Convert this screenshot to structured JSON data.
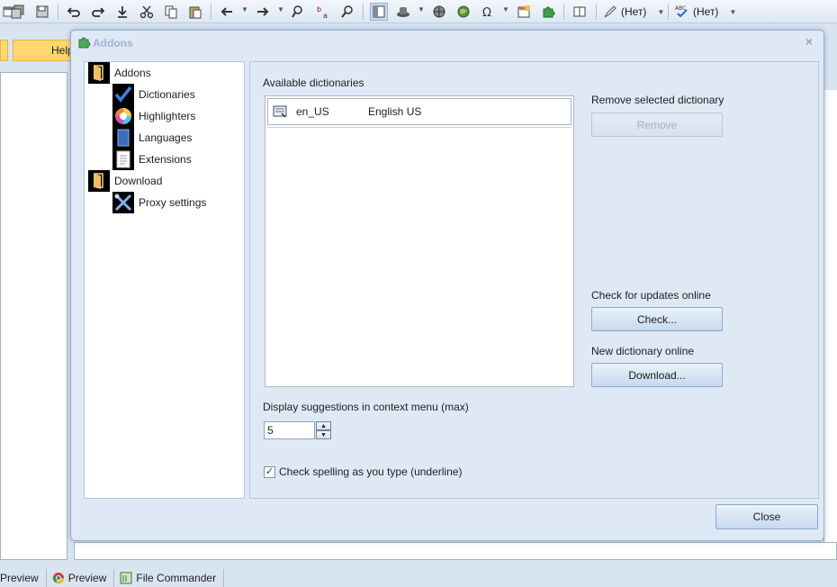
{
  "background": {
    "toolbar": {
      "icons": [
        "window-icon",
        "save-all-icon",
        "save-icon",
        "undo-icon",
        "redo-icon",
        "download-icon",
        "cut-icon",
        "copy-icon",
        "paste-icon",
        "back-icon",
        "forward-icon",
        "find-icon",
        "replace-icon",
        "find-next-icon",
        "layout-icon",
        "hat-icon",
        "globe-icon",
        "globe-green-icon",
        "omega-icon",
        "calendar-icon",
        "puzzle-icon",
        "split-icon"
      ],
      "style_combo_label": "(Нет)",
      "spell_combo_label": "(Нет)"
    },
    "tab_label": "Help",
    "taskbar": [
      {
        "label": "Preview"
      },
      {
        "label": "Preview"
      },
      {
        "label": "File Commander"
      }
    ]
  },
  "dialog": {
    "title": "Addons",
    "close_glyph": "×",
    "tree": [
      {
        "label": "Addons",
        "icon": "folder-icon",
        "level": 0
      },
      {
        "label": "Dictionaries",
        "icon": "checkmark-icon",
        "level": 1
      },
      {
        "label": "Highlighters",
        "icon": "color-wheel-icon",
        "level": 1
      },
      {
        "label": "Languages",
        "icon": "book-icon",
        "level": 1
      },
      {
        "label": "Extensions",
        "icon": "document-icon",
        "level": 1
      },
      {
        "label": "Download",
        "icon": "folder-icon",
        "level": 0
      },
      {
        "label": "Proxy settings",
        "icon": "tools-icon",
        "level": 1
      }
    ],
    "available_label": "Available dictionaries",
    "dictionaries": [
      {
        "code": "en_US",
        "name": "English US"
      }
    ],
    "remove_section_label": "Remove selected dictionary",
    "remove_button": "Remove",
    "check_section_label": "Check for updates online",
    "check_button": "Check...",
    "new_dict_label": "New dictionary online",
    "download_button": "Download...",
    "suggestions_label": "Display suggestions in context menu (max)",
    "suggestions_value": "5",
    "spell_check_label": "Check spelling as you type (underline)",
    "spell_check_checked": true,
    "close_button": "Close"
  }
}
